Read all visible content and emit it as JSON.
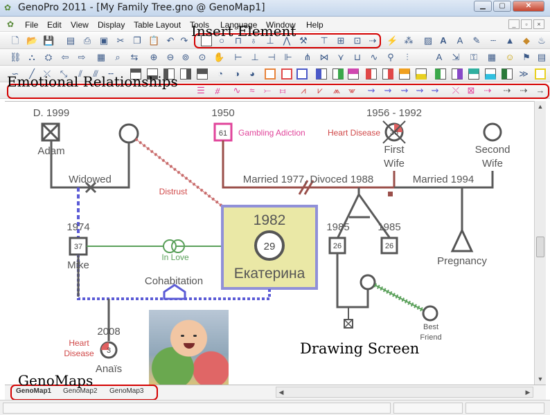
{
  "window": {
    "title": "GenoPro 2011 - [My Family Tree.gno @ GenoMap1]"
  },
  "menu": [
    "File",
    "Edit",
    "View",
    "Display",
    "Table Layout",
    "Tools",
    "Language",
    "Window",
    "Help"
  ],
  "annotations": {
    "insert_element": "Insert Element",
    "emotional_relationships": "Emotional Relationships",
    "drawing_screen": "Drawing Screen",
    "genomaps": "GenoMaps"
  },
  "genogram": {
    "adam": {
      "year": "D. 1999",
      "name": "Adam"
    },
    "adam_partner_year": "",
    "widowed": "Widowed",
    "distrust": "Distrust",
    "man_1950": {
      "year": "1950",
      "age": "61",
      "condition": "Gambling Adiction"
    },
    "first_wife": {
      "year": "1956 - 1992",
      "age": "36",
      "condition": "Heart Disease",
      "name": "First Wife"
    },
    "second_wife": {
      "name": "Second Wife"
    },
    "married_divorced": "Married 1977, Divoced 1988",
    "married_1994": "Married 1994",
    "mike": {
      "year": "1974",
      "age": "37",
      "name": "Mike"
    },
    "in_love": "In Love",
    "ekaterina": {
      "year": "1982",
      "age": "29",
      "name": "Екатерина"
    },
    "twin_left": {
      "year": "1985",
      "age": "26"
    },
    "twin_right": {
      "year": "1985",
      "age": "26"
    },
    "pregnancy": "Pregnancy",
    "cohabitation": "Cohabitation",
    "anais": {
      "year": "2008",
      "age": "3",
      "condition": "Heart Disease",
      "name": "Anaïs"
    },
    "best_friend": "Best Friend"
  },
  "tabs": [
    "GenoMap1",
    "GenoMap2",
    "GenoMap3"
  ],
  "colors": {
    "male_line": "#5a5a5a",
    "pink": "#e0449a",
    "divorced": "#9a4f4a",
    "blue": "#5b5bd6",
    "green": "#5aa05a",
    "red_label": "#d04848",
    "annot_red": "#d40000"
  }
}
